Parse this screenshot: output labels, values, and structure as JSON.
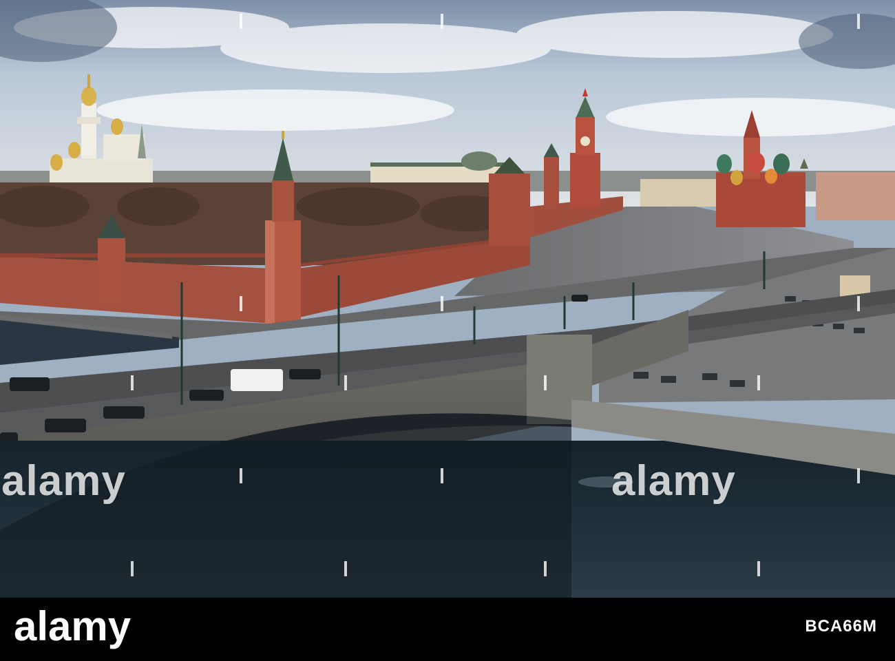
{
  "watermark": {
    "text": "alamy"
  },
  "footer": {
    "logo": "alamy",
    "image_id": "BCA66M",
    "background": "#000000",
    "text_color": "#ffffff"
  },
  "scene": {
    "sky_color": "#b8c6d6",
    "water_color": "#1f2a33",
    "wall_color": "#a24c3c",
    "road_color": "#5c5d5f"
  }
}
